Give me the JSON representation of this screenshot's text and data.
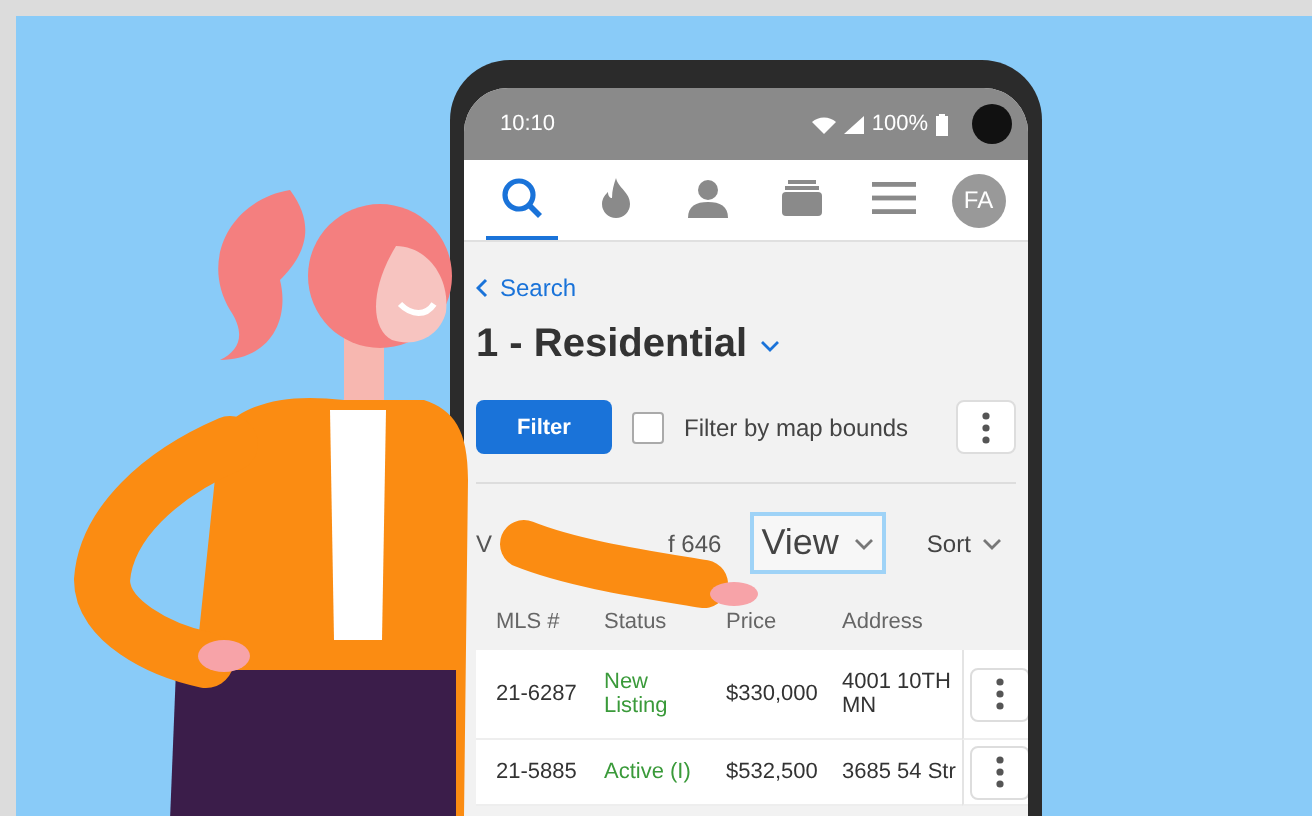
{
  "status_bar": {
    "time": "10:10",
    "battery": "100%"
  },
  "nav_tabs": [
    {
      "kind": "search",
      "selected": true
    },
    {
      "kind": "flame",
      "selected": false
    },
    {
      "kind": "person",
      "selected": false
    },
    {
      "kind": "box",
      "selected": false
    },
    {
      "kind": "menu",
      "selected": false
    },
    {
      "kind": "avatar",
      "label": "FA",
      "selected": false
    }
  ],
  "back_link": "Search",
  "title": "1 - Residential",
  "filter_button": "Filter",
  "map_bounds": {
    "label": "Filter by map bounds",
    "checked": false
  },
  "results": {
    "start": "V",
    "end": "f 646"
  },
  "view_dropdown": {
    "label": "View",
    "highlighted": true
  },
  "sort": "Sort",
  "table": {
    "columns": [
      "MLS #",
      "Status",
      "Price",
      "Address"
    ],
    "rows": [
      {
        "mls": "21-6287",
        "status": "New Listing",
        "color": "#3a9a3a",
        "price": "$330,000",
        "address": "4001 10TH MN"
      },
      {
        "mls": "21-5885",
        "status": "Active (I)",
        "color": "#3a9a3a",
        "price": "$532,500",
        "address": "3685 54 Str"
      }
    ]
  }
}
